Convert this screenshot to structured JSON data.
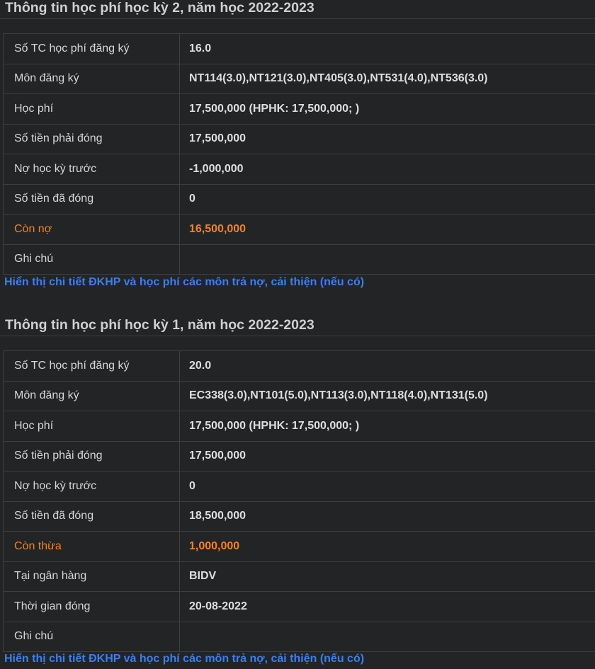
{
  "semester2": {
    "title": "Thông tin học phí học kỳ 2, năm học 2022-2023",
    "rows": [
      {
        "label": "Số TC học phí đăng ký",
        "value": "16.0"
      },
      {
        "label": "Môn đăng ký",
        "value": "NT114(3.0),NT121(3.0),NT405(3.0),NT531(4.0),NT536(3.0)"
      },
      {
        "label": "Học phí",
        "value": "17,500,000 (HPHK: 17,500,000; )"
      },
      {
        "label": "Số tiền phải đóng",
        "value": "17,500,000"
      },
      {
        "label": "Nợ học kỳ trước",
        "value": "-1,000,000"
      },
      {
        "label": "Số tiền đã đóng",
        "value": "0"
      },
      {
        "label": "Còn nợ",
        "value": "16,500,000"
      },
      {
        "label": "Ghi chú",
        "value": ""
      }
    ],
    "detail_link": "Hiển thị chi tiết ĐKHP và học phí các môn trả nợ, cải thiện (nếu có)"
  },
  "semester1": {
    "title": "Thông tin học phí học kỳ 1, năm học 2022-2023",
    "rows": [
      {
        "label": "Số TC học phí đăng ký",
        "value": "20.0"
      },
      {
        "label": "Môn đăng ký",
        "value": "EC338(3.0),NT101(5.0),NT113(3.0),NT118(4.0),NT131(5.0)"
      },
      {
        "label": "Học phí",
        "value": "17,500,000 (HPHK: 17,500,000; )"
      },
      {
        "label": "Số tiền phải đóng",
        "value": "17,500,000"
      },
      {
        "label": "Nợ học kỳ trước",
        "value": "0"
      },
      {
        "label": "Số tiền đã đóng",
        "value": "18,500,000"
      },
      {
        "label": "Còn thừa",
        "value": "1,000,000"
      },
      {
        "label": "Tại ngân hàng",
        "value": "BIDV"
      },
      {
        "label": "Thời gian đóng",
        "value": "20-08-2022"
      },
      {
        "label": "Ghi chú",
        "value": ""
      }
    ],
    "detail_link": "Hiển thị chi tiết ĐKHP và học phí các môn trả nợ, cải thiện (nếu có)"
  },
  "colors": {
    "background": "#232425",
    "text": "#d6d6d6",
    "highlight": "#f0832a",
    "link": "#3b7ff0",
    "border": "#3d3e3f"
  }
}
